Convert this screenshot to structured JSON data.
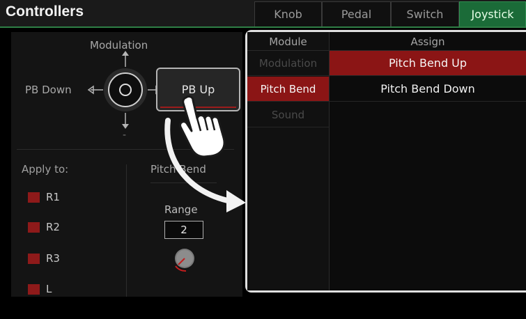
{
  "header": {
    "title": "Controllers",
    "tabs": [
      {
        "label": "Knob",
        "active": false
      },
      {
        "label": "Pedal",
        "active": false
      },
      {
        "label": "Switch",
        "active": false
      },
      {
        "label": "Joystick",
        "active": true
      }
    ]
  },
  "joystick": {
    "up_label": "Modulation",
    "left_label": "PB Down",
    "right_button_label": "PB Up",
    "down_label": "-"
  },
  "apply": {
    "label": "Apply to:",
    "regions": [
      "R1",
      "R2",
      "R3",
      "L"
    ]
  },
  "pitch_bend": {
    "label": "Pitch Bend",
    "range_label": "Range",
    "range_value": "2"
  },
  "assign_panel": {
    "module_header": "Module",
    "assign_header": "Assign",
    "modules": [
      {
        "label": "Modulation",
        "state": "dim"
      },
      {
        "label": "Pitch Bend",
        "state": "selected"
      },
      {
        "label": "Sound",
        "state": "dim"
      }
    ],
    "assigns": [
      {
        "label": "Pitch Bend Up",
        "selected": true
      },
      {
        "label": "Pitch Bend Down",
        "selected": false
      }
    ]
  },
  "colors": {
    "accent_green": "#1b6b38",
    "selection_red": "#8b1515",
    "highlight_border": "#e0e0e0"
  }
}
